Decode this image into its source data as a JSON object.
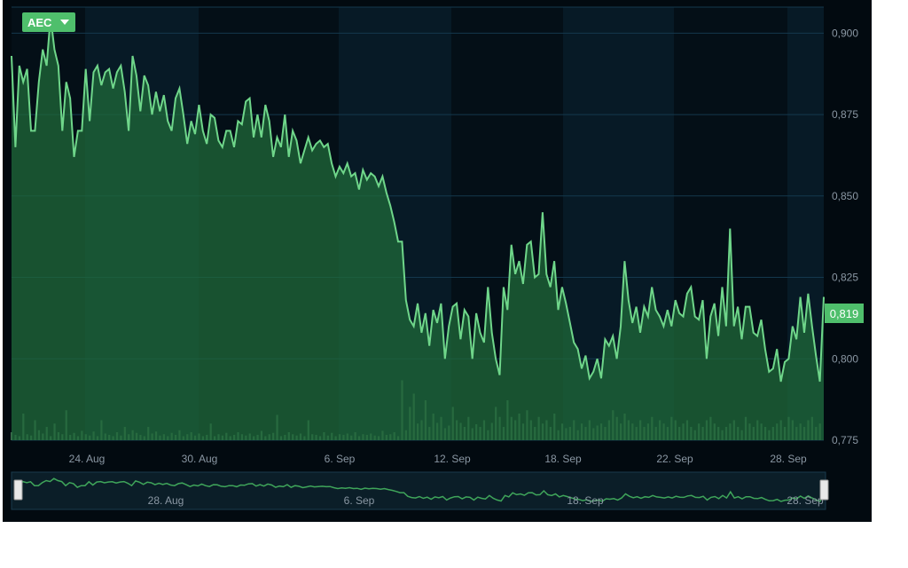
{
  "symbol": {
    "label": "AEC",
    "icon": "caret-down-icon"
  },
  "last_price_label": "0,819",
  "colors": {
    "line": "#6fd68a",
    "area": "#1f6a3a",
    "volume": "#4b7d5a",
    "background": "#020a10",
    "grid": "#14384d",
    "accent": "#4fbf6c"
  },
  "navigator": {
    "tick_labels": [
      "28. Aug",
      "6. Sep",
      "18. Sep",
      "28. Sep"
    ]
  },
  "chart_data": {
    "type": "area",
    "x_tick_labels": [
      "24. Aug",
      "30. Aug",
      "6. Sep",
      "12. Sep",
      "18. Sep",
      "22. Sep",
      "28. Sep"
    ],
    "y_tick_labels": [
      "0,775",
      "0,800",
      "0,825",
      "0,850",
      "0,875",
      "0,900"
    ],
    "ylim": [
      0.775,
      0.908
    ],
    "x_range_days": [
      "2017-08-21",
      "2017-09-30"
    ],
    "series": [
      {
        "values": [
          0.893,
          0.865,
          0.89,
          0.885,
          0.889,
          0.87,
          0.87,
          0.885,
          0.895,
          0.89,
          0.905,
          0.895,
          0.89,
          0.87,
          0.885,
          0.88,
          0.862,
          0.87,
          0.87,
          0.889,
          0.873,
          0.888,
          0.89,
          0.884,
          0.888,
          0.889,
          0.883,
          0.888,
          0.89,
          0.882,
          0.87,
          0.893,
          0.887,
          0.876,
          0.887,
          0.884,
          0.875,
          0.882,
          0.876,
          0.881,
          0.873,
          0.87,
          0.88,
          0.883,
          0.875,
          0.866,
          0.873,
          0.869,
          0.878,
          0.87,
          0.866,
          0.875,
          0.874,
          0.867,
          0.865,
          0.87,
          0.87,
          0.865,
          0.873,
          0.872,
          0.879,
          0.88,
          0.868,
          0.875,
          0.868,
          0.878,
          0.873,
          0.862,
          0.868,
          0.865,
          0.875,
          0.862,
          0.87,
          0.867,
          0.86,
          0.864,
          0.868,
          0.864,
          0.866,
          0.867,
          0.865,
          0.866,
          0.86,
          0.856,
          0.859,
          0.857,
          0.86,
          0.856,
          0.857,
          0.852,
          0.858,
          0.855,
          0.857,
          0.856,
          0.853,
          0.856,
          0.851,
          0.847,
          0.842,
          0.836,
          0.836,
          0.818,
          0.812,
          0.81,
          0.817,
          0.808,
          0.814,
          0.804,
          0.815,
          0.811,
          0.817,
          0.8,
          0.81,
          0.816,
          0.817,
          0.806,
          0.815,
          0.813,
          0.8,
          0.814,
          0.808,
          0.805,
          0.822,
          0.808,
          0.8,
          0.795,
          0.822,
          0.815,
          0.835,
          0.826,
          0.83,
          0.823,
          0.835,
          0.836,
          0.825,
          0.826,
          0.845,
          0.826,
          0.822,
          0.83,
          0.815,
          0.822,
          0.817,
          0.811,
          0.805,
          0.803,
          0.797,
          0.801,
          0.794,
          0.796,
          0.8,
          0.794,
          0.806,
          0.804,
          0.807,
          0.8,
          0.81,
          0.83,
          0.818,
          0.811,
          0.816,
          0.808,
          0.816,
          0.813,
          0.822,
          0.815,
          0.813,
          0.81,
          0.815,
          0.81,
          0.818,
          0.814,
          0.813,
          0.82,
          0.822,
          0.813,
          0.812,
          0.818,
          0.8,
          0.813,
          0.817,
          0.807,
          0.822,
          0.81,
          0.84,
          0.81,
          0.816,
          0.806,
          0.816,
          0.816,
          0.808,
          0.807,
          0.812,
          0.803,
          0.796,
          0.797,
          0.803,
          0.793,
          0.799,
          0.8,
          0.81,
          0.806,
          0.819,
          0.808,
          0.82,
          0.81,
          0.801,
          0.793,
          0.819
        ],
        "volume_max": 1000,
        "volumes": [
          120,
          80,
          60,
          400,
          90,
          70,
          300,
          150,
          100,
          200,
          60,
          250,
          120,
          90,
          450,
          80,
          110,
          60,
          140,
          90,
          70,
          130,
          60,
          300,
          100,
          80,
          60,
          120,
          70,
          200,
          90,
          150,
          110,
          80,
          60,
          200,
          100,
          130,
          70,
          90,
          60,
          110,
          80,
          150,
          60,
          90,
          120,
          70,
          100,
          60,
          80,
          250,
          60,
          90,
          70,
          110,
          60,
          80,
          120,
          90,
          70,
          100,
          60,
          80,
          140,
          60,
          90,
          110,
          380,
          60,
          80,
          120,
          90,
          70,
          100,
          60,
          300,
          90,
          80,
          60,
          120,
          70,
          110,
          60,
          90,
          80,
          100,
          70,
          120,
          60,
          90,
          80,
          100,
          70,
          60,
          140,
          80,
          90,
          120,
          60,
          900,
          150,
          500,
          700,
          250,
          300,
          600,
          200,
          400,
          260,
          350,
          180,
          220,
          500,
          300,
          260,
          200,
          350,
          180,
          240,
          200,
          300,
          150,
          260,
          500,
          350,
          200,
          600,
          350,
          300,
          400,
          250,
          450,
          300,
          200,
          350,
          250,
          300,
          200,
          400,
          150,
          250,
          180,
          200,
          300,
          150,
          250,
          200,
          300,
          180,
          220,
          250,
          200,
          300,
          450,
          350,
          250,
          400,
          300,
          250,
          200,
          300,
          200,
          250,
          350,
          200,
          300,
          250,
          200,
          350,
          300,
          200,
          250,
          300,
          200,
          150,
          250,
          200,
          300,
          350,
          250,
          200,
          150,
          200,
          250,
          300,
          200,
          150,
          350,
          250,
          200,
          300,
          250,
          200,
          150,
          200,
          250,
          300,
          200,
          350,
          300,
          200,
          250,
          200,
          300,
          350,
          200,
          250
        ]
      }
    ]
  }
}
